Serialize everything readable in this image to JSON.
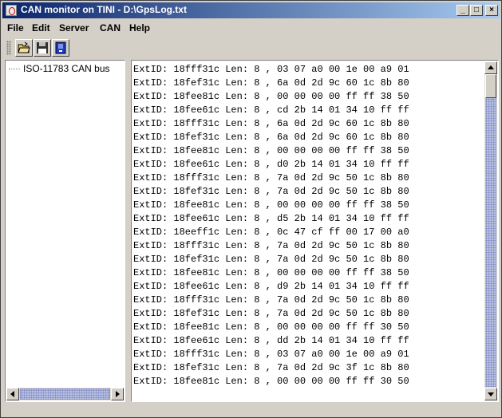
{
  "window": {
    "title": "CAN monitor on TINI - D:\\GpsLog.txt"
  },
  "title_buttons": {
    "minimize": "_",
    "maximize": "□",
    "close": "×"
  },
  "menu": [
    "File",
    "Edit",
    "Server",
    "CAN",
    "Help"
  ],
  "toolbar": {
    "icons": [
      "open-folder-icon",
      "save-disk-icon",
      "connect-icon"
    ]
  },
  "tree": {
    "root": "ISO-11783 CAN bus"
  },
  "log": [
    "ExtID: 18fff31c Len: 8 , 03 07 a0 00 1e 00 a9 01",
    "ExtID: 18fef31c Len: 8 , 6a 0d 2d 9c 60 1c 8b 80",
    "ExtID: 18fee81c Len: 8 , 00 00 00 00 ff ff 38 50",
    "ExtID: 18fee61c Len: 8 , cd 2b 14 01 34 10 ff ff",
    "ExtID: 18fff31c Len: 8 , 6a 0d 2d 9c 60 1c 8b 80",
    "ExtID: 18fef31c Len: 8 , 6a 0d 2d 9c 60 1c 8b 80",
    "ExtID: 18fee81c Len: 8 , 00 00 00 00 ff ff 38 50",
    "ExtID: 18fee61c Len: 8 , d0 2b 14 01 34 10 ff ff",
    "ExtID: 18fff31c Len: 8 , 7a 0d 2d 9c 50 1c 8b 80",
    "ExtID: 18fef31c Len: 8 , 7a 0d 2d 9c 50 1c 8b 80",
    "ExtID: 18fee81c Len: 8 , 00 00 00 00 ff ff 38 50",
    "ExtID: 18fee61c Len: 8 , d5 2b 14 01 34 10 ff ff",
    "ExtID: 18eeff1c Len: 8 , 0c 47 cf ff 00 17 00 a0",
    "ExtID: 18fff31c Len: 8 , 7a 0d 2d 9c 50 1c 8b 80",
    "ExtID: 18fef31c Len: 8 , 7a 0d 2d 9c 50 1c 8b 80",
    "ExtID: 18fee81c Len: 8 , 00 00 00 00 ff ff 38 50",
    "ExtID: 18fee61c Len: 8 , d9 2b 14 01 34 10 ff ff",
    "ExtID: 18fff31c Len: 8 , 7a 0d 2d 9c 50 1c 8b 80",
    "ExtID: 18fef31c Len: 8 , 7a 0d 2d 9c 50 1c 8b 80",
    "ExtID: 18fee81c Len: 8 , 00 00 00 00 ff ff 30 50",
    "ExtID: 18fee61c Len: 8 , dd 2b 14 01 34 10 ff ff",
    "ExtID: 18fff31c Len: 8 , 03 07 a0 00 1e 00 a9 01",
    "ExtID: 18fef31c Len: 8 , 7a 0d 2d 9c 3f 1c 8b 80",
    "ExtID: 18fee81c Len: 8 , 00 00 00 00 ff ff 30 50"
  ],
  "colors": {
    "title_start": "#0a246a",
    "title_end": "#a6caf0",
    "scroll_track": "#b7bfe0"
  }
}
